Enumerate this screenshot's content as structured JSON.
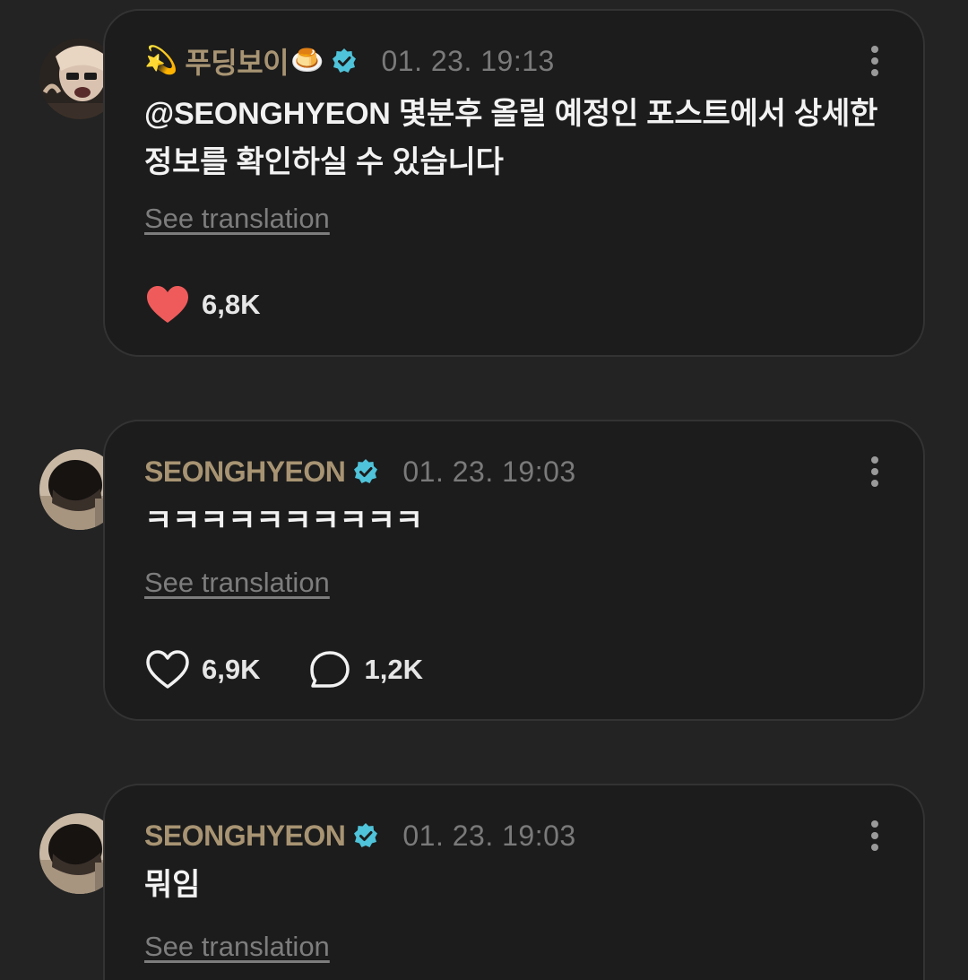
{
  "comments": [
    {
      "prefix_emoji": "💫",
      "username": "푸딩보이",
      "suffix_emoji": "🍮",
      "verified": true,
      "timestamp": "01. 23. 19:13",
      "text": "@SEONGHYEON 몇분후 올릴 예정인 포스트에서 상세한 정보를 확인하실 수 있습니다",
      "translate_label": "See translation",
      "liked": true,
      "like_count": "6,8K"
    },
    {
      "username": "SEONGHYEON",
      "verified": true,
      "timestamp": "01. 23. 19:03",
      "text": "ㅋㅋㅋㅋㅋㅋㅋㅋㅋㅋ",
      "translate_label": "See translation",
      "liked": false,
      "like_count": "6,9K",
      "reply_count": "1,2K"
    },
    {
      "username": "SEONGHYEON",
      "verified": true,
      "timestamp": "01. 23. 19:03",
      "text": "뭐임",
      "translate_label": "See translation"
    }
  ],
  "colors": {
    "background": "#232323",
    "card": "#1c1c1c",
    "username": "#a89473",
    "verified": "#4fc3d9",
    "heart_liked": "#ef5b5b"
  },
  "icons": {
    "verified": "verified-badge-icon",
    "more": "more-vertical-icon",
    "like": "heart-icon",
    "reply": "speech-bubble-icon"
  }
}
